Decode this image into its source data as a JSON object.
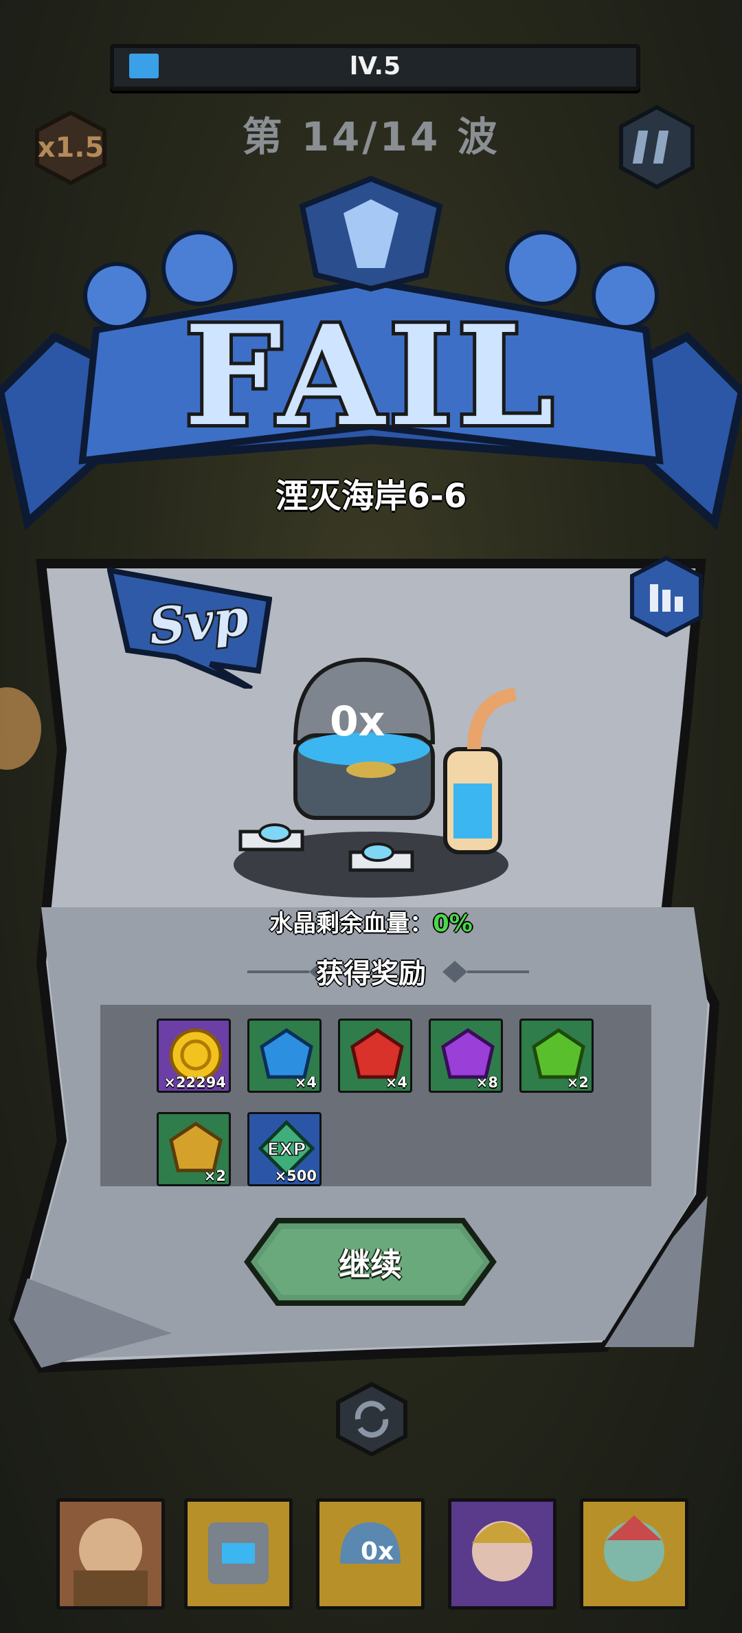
{
  "hud": {
    "level_label": "lV.5",
    "level_progress": 0.06,
    "wave_text": "第 14/14 波",
    "speed_label": "x1.5"
  },
  "result": {
    "title": "FAIL",
    "stage_name": "湮灭海岸6-6",
    "svp_label": "Svp",
    "crystal_label": "水晶剩余血量：",
    "crystal_value": "0%"
  },
  "rewards": {
    "title": "获得奖励",
    "items": [
      {
        "icon": "gold-coin-icon",
        "count": "×22294",
        "color": "#6b3fa6"
      },
      {
        "icon": "blue-gem-icon",
        "count": "×4",
        "color": "#2f7d4a"
      },
      {
        "icon": "red-gem-icon",
        "count": "×4",
        "color": "#2f7d4a"
      },
      {
        "icon": "purple-gem-icon",
        "count": "×8",
        "color": "#2f7d4a"
      },
      {
        "icon": "green-gem-icon",
        "count": "×2",
        "color": "#2f7d4a"
      },
      {
        "icon": "yellow-gem-icon",
        "count": "×2",
        "color": "#2f7d4a"
      },
      {
        "icon": "exp-icon",
        "count": "×500",
        "color": "#2b56a8"
      }
    ]
  },
  "actions": {
    "continue_label": "继续"
  },
  "hero_bar": {
    "slots": [
      "hero-portrait-1",
      "hero-portrait-2",
      "hero-portrait-3",
      "hero-portrait-4",
      "hero-portrait-5"
    ]
  }
}
